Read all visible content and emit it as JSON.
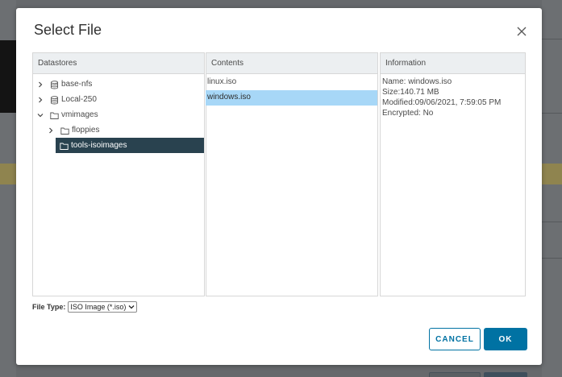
{
  "dialog": {
    "title": "Select File"
  },
  "datastores": {
    "header": "Datastores",
    "items": [
      {
        "label": "base-nfs",
        "icon": "database-icon",
        "chevron": "right"
      },
      {
        "label": "Local-250",
        "icon": "database-icon",
        "chevron": "right"
      },
      {
        "label": "vmimages",
        "icon": "folder-icon",
        "chevron": "down"
      },
      {
        "label": "floppies",
        "icon": "folder-icon",
        "chevron": "right"
      },
      {
        "label": "tools-isoimages",
        "icon": "folder-icon",
        "chevron": "none",
        "selected": true
      }
    ]
  },
  "contents": {
    "header": "Contents",
    "items": [
      {
        "label": "linux.iso"
      },
      {
        "label": "windows.iso",
        "selected": true
      }
    ]
  },
  "information": {
    "header": "Information",
    "name": "Name: windows.iso",
    "size": "Size:140.71 MB",
    "modified": "Modified:09/06/2021, 7:59:05 PM",
    "encrypted": "Encrypted: No"
  },
  "file_type": {
    "label": "File Type:",
    "selected": "ISO Image (*.iso)"
  },
  "buttons": {
    "cancel": "CANCEL",
    "ok": "OK"
  },
  "colors": {
    "accent": "#0072a3",
    "tree_selected_bg": "#29424f",
    "list_selected_bg": "#a7d7f7",
    "panel_header_bg": "#eceff1"
  }
}
